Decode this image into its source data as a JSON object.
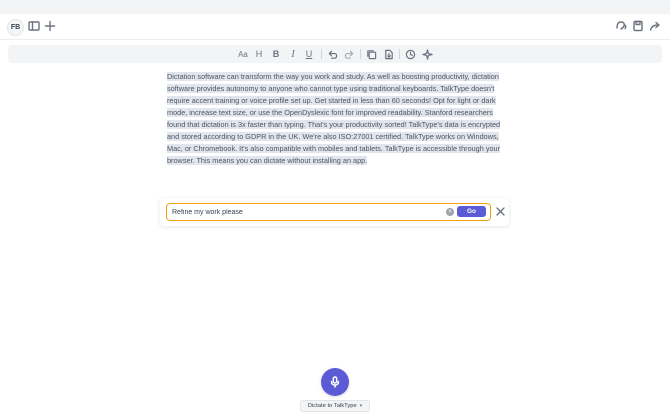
{
  "header": {
    "avatar_initials": "FB",
    "icons": [
      "sidebar-toggle-icon",
      "plus-icon",
      "listen-icon",
      "save-icon",
      "share-icon"
    ]
  },
  "toolbar": {
    "font_label": "Aa",
    "heading_label": "H",
    "bold_label": "B",
    "italic_label": "I",
    "underline_label": "U",
    "icons": [
      "undo-icon",
      "redo-icon",
      "copy-icon",
      "export-icon",
      "history-icon",
      "sparkle-icon"
    ]
  },
  "document": {
    "text": "Dictation software can transform the way you work and study. As well as boosting productivity, dictation software provides autonomy to anyone who cannot type using traditional keyboards. TalkType doesn't require accent training or voice profile set up. Get started in less than 60 seconds! Opt for light or dark mode, increase text size, or use the OpenDyslexic font for improved readability. Stanford researchers found that dictation is 3x faster than typing. That's your productivity sorted! TalkType's data is encrypted and stored according to GDPR in the UK. We're also ISO:27001 certified. TalkType works on Windows, Mac, or Chromebook. It's also compatible with mobiles and tablets. TalkType is accessible through your browser. This means you can dictate without installing an app.",
    "highlighted": true
  },
  "refine": {
    "value": "Refine my work please",
    "go_label": "Go"
  },
  "footer": {
    "dictate_label": "Dictate to TalkType"
  },
  "colors": {
    "accent": "#5b5bd6",
    "focus_border": "#f59e0b",
    "highlight": "#e2e6ec"
  }
}
